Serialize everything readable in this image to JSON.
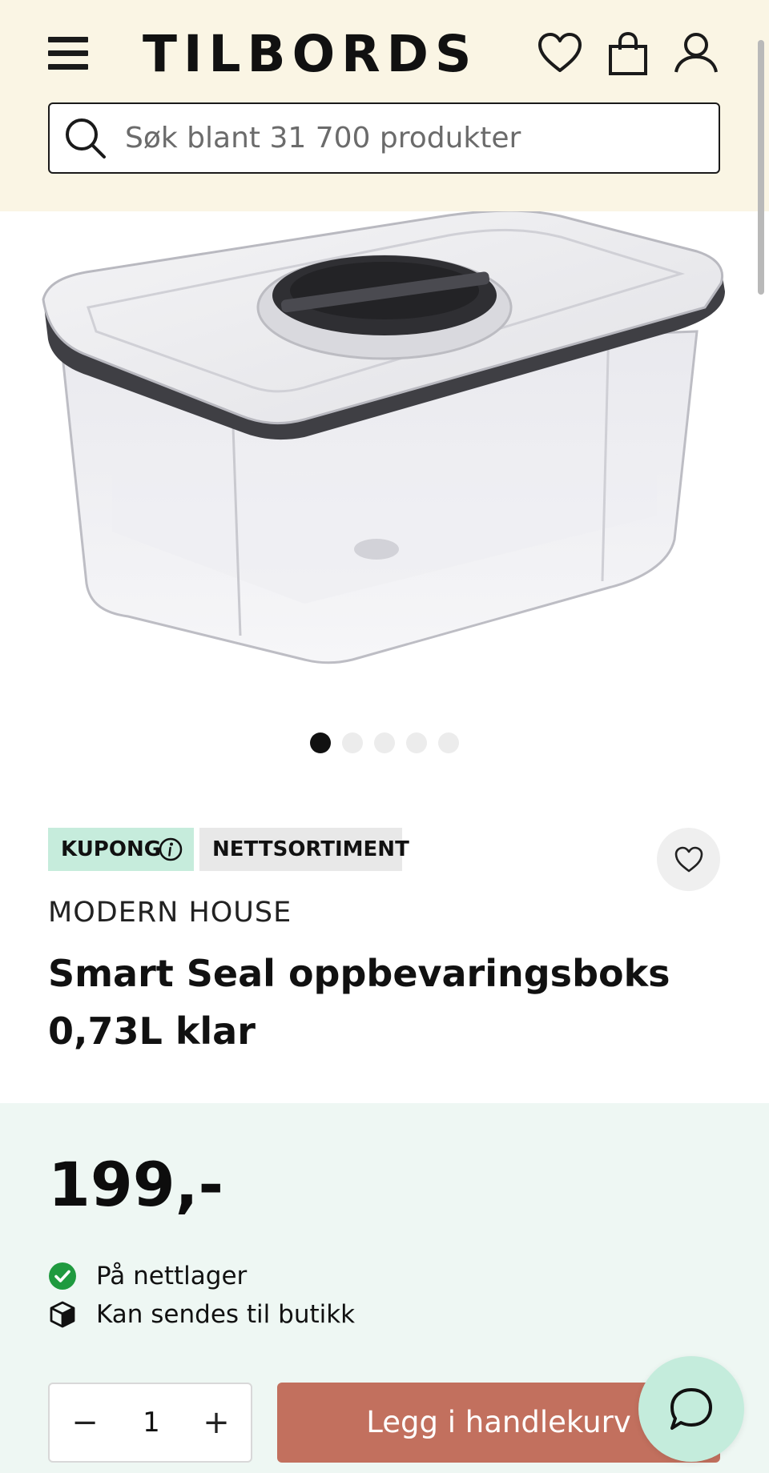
{
  "header": {
    "logo": "TILBORDS",
    "icons": [
      "menu-icon",
      "heart-icon",
      "shopping-bag-icon",
      "user-icon"
    ],
    "search": {
      "placeholder": "Søk blant 31 700 produkter",
      "value": ""
    },
    "background": "#faf5e4"
  },
  "carousel": {
    "total": 5,
    "active": 1
  },
  "product": {
    "badges": {
      "coupon": "KUPONG",
      "online": "NETTSORTIMENT"
    },
    "brand": "MODERN HOUSE",
    "title": "Smart Seal oppbevaringsboks 0,73L klar",
    "price": "199,-",
    "availability": [
      {
        "icon": "check-circle-icon",
        "text": "På nettlager"
      },
      {
        "icon": "package-icon",
        "text": "Kan sendes til butikk"
      }
    ]
  },
  "purchase": {
    "quantity": "1",
    "minus": "−",
    "plus": "+",
    "add_to_cart": "Legg i handlekurv"
  },
  "colors": {
    "accent_cart": "#c2705e",
    "coupon_badge": "#c6ecdc",
    "price_panel": "#eef7f3",
    "in_stock_green": "#1f9a3f",
    "chat_bubble": "#c4ecdc"
  }
}
